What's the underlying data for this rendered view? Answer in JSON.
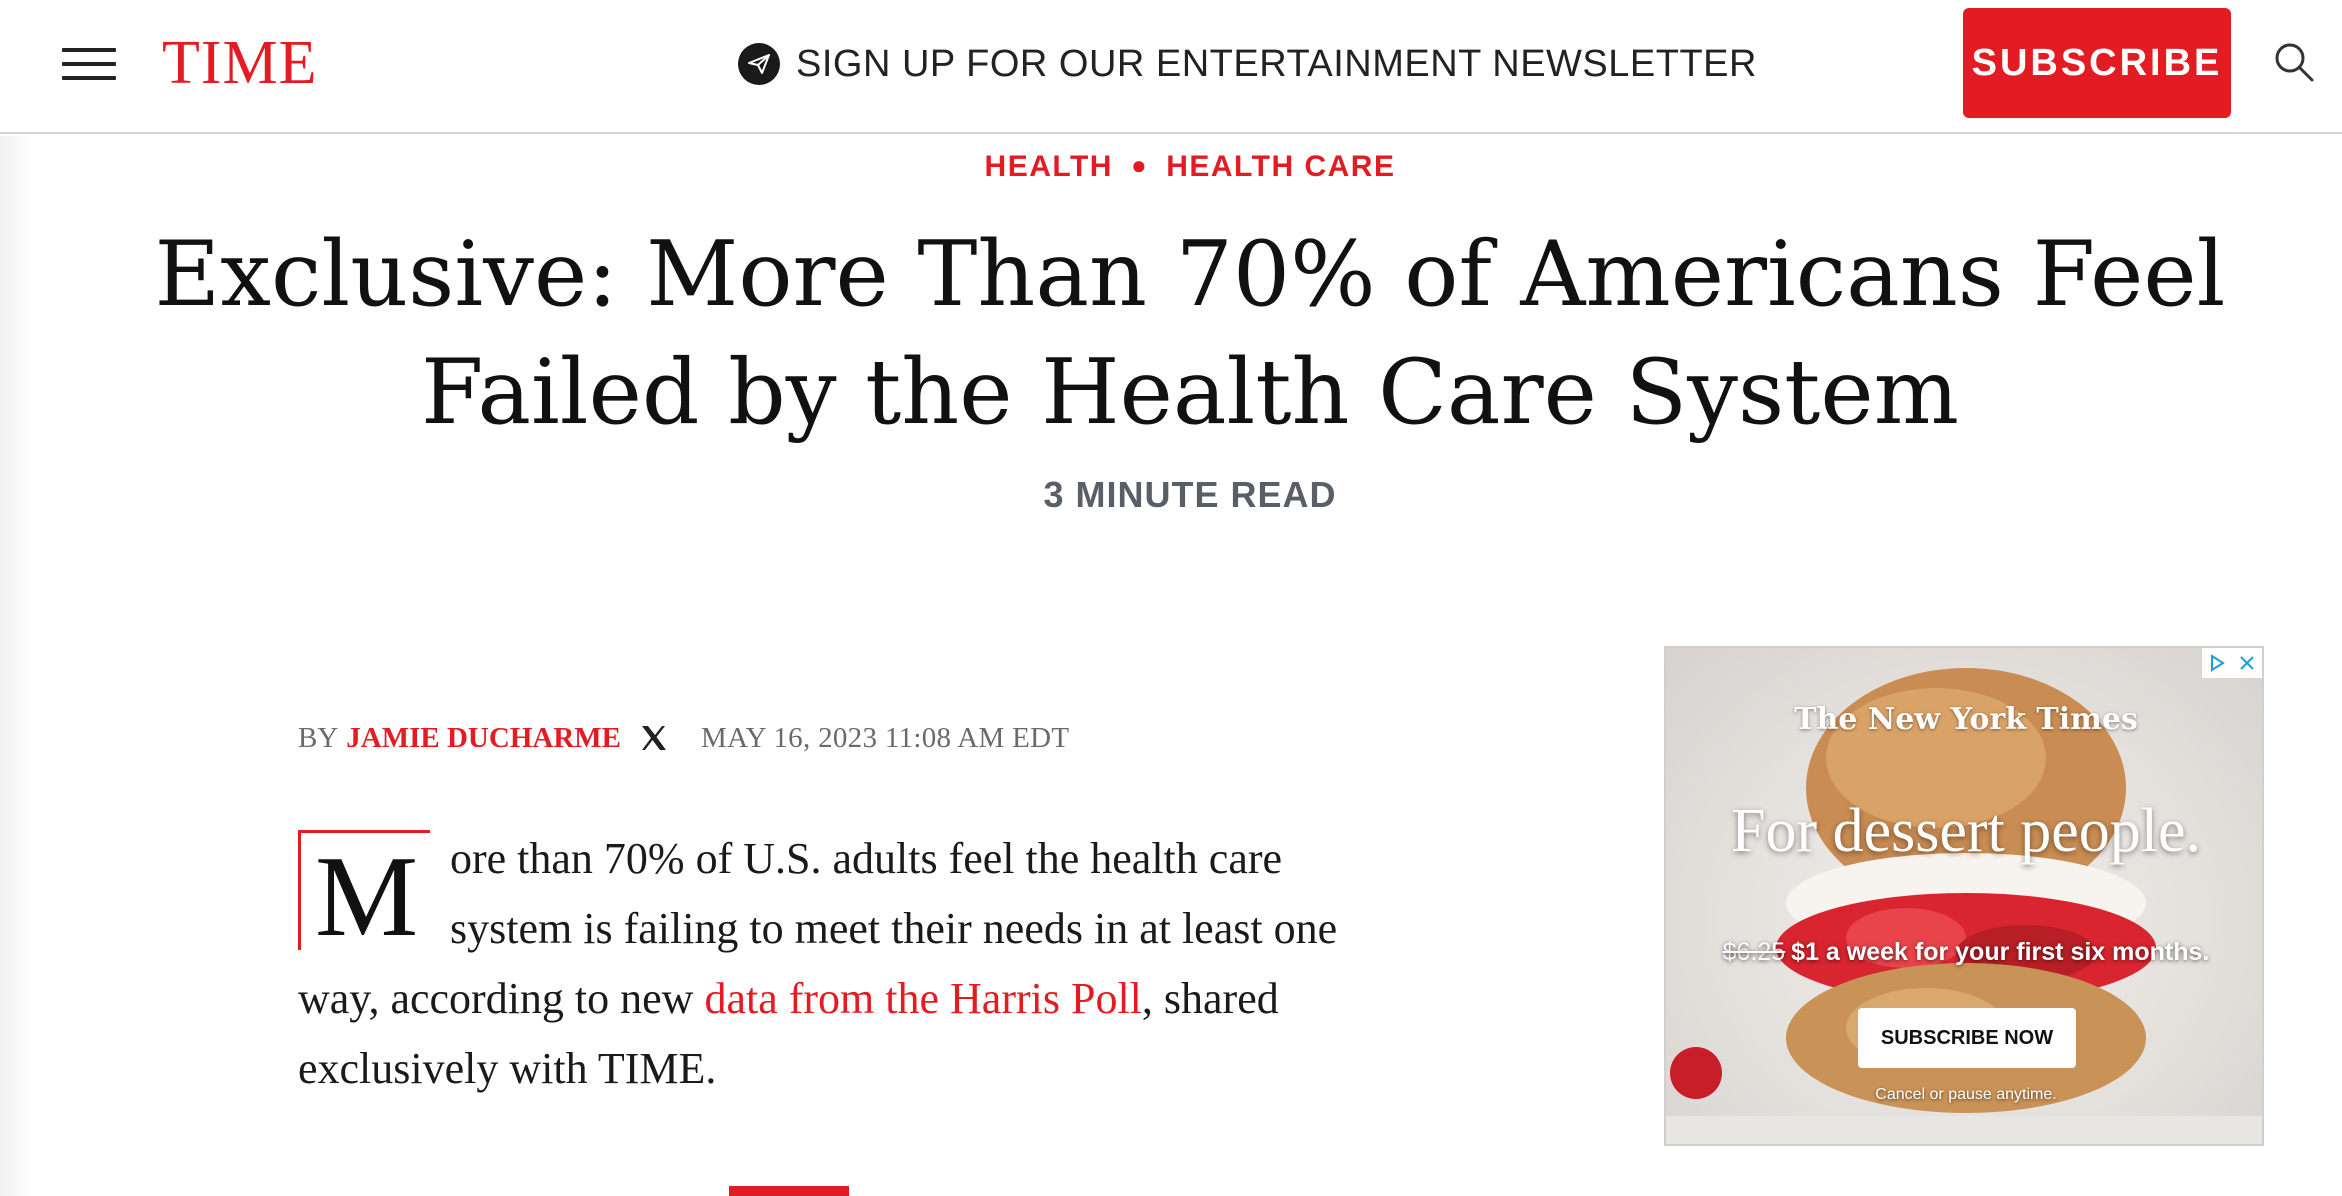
{
  "header": {
    "logo": "TIME",
    "newsletter_label": "SIGN UP FOR OUR ENTERTAINMENT NEWSLETTER",
    "subscribe_label": "SUBSCRIBE"
  },
  "article": {
    "kicker": [
      "HEALTH",
      "HEALTH CARE"
    ],
    "headline_line1": "Exclusive: More Than 70% of Americans Feel",
    "headline_line2": "Failed by the Health Care System",
    "read_time": "3 MINUTE READ",
    "byline": {
      "prefix": "BY",
      "author": "JAMIE DUCHARME",
      "date": "MAY 16, 2023 11:08 AM EDT"
    },
    "body": {
      "dropcap": "M",
      "text_before_link": "ore than 70% of U.S. adults feel the health care system is failing to meet their needs in at least one way, according to new ",
      "link_text": "data from the Harris Poll",
      "text_after_link": ", shared exclusively with TIME."
    }
  },
  "ad": {
    "brand": "The New York Times",
    "headline": "For dessert people.",
    "old_price": "$6.25",
    "offer": "$1 a week for your first six months.",
    "cta": "SUBSCRIBE NOW",
    "fine_print": "Cancel or pause anytime."
  },
  "colors": {
    "brand_red": "#e31b23",
    "meta_gray": "#5a5e66"
  },
  "icons": [
    "menu-icon",
    "paper-plane-icon",
    "search-icon",
    "x-social-icon",
    "adchoices-icon",
    "ad-close-icon"
  ]
}
